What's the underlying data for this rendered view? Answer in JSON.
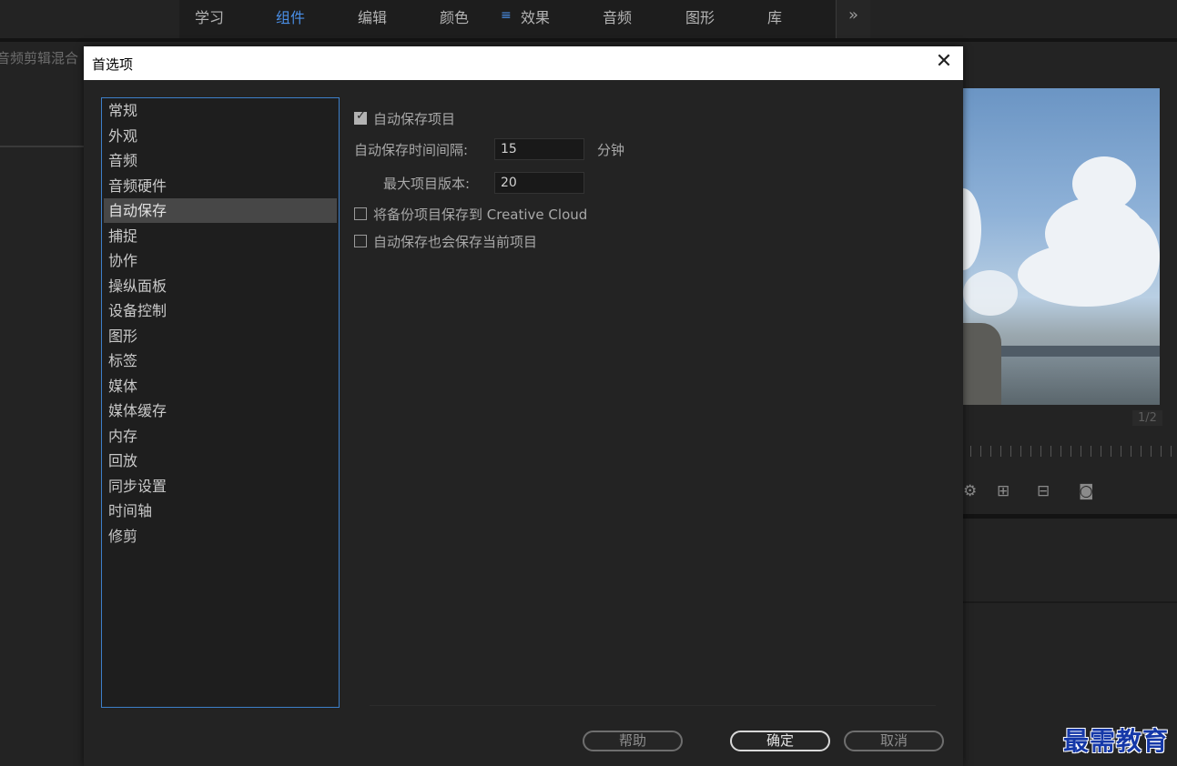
{
  "workspace_tabs": [
    "学习",
    "组件",
    "编辑",
    "颜色",
    "效果",
    "音频",
    "图形",
    "库"
  ],
  "active_tab": "组件",
  "menu_icon": "≡",
  "more_icon": "»",
  "left_panel_title": "音频剪辑混合",
  "program_monitor": {
    "page_indicator": "1/2"
  },
  "dialog": {
    "title": "首选项",
    "close_icon": "close-icon",
    "categories": [
      "常规",
      "外观",
      "音频",
      "音频硬件",
      "自动保存",
      "捕捉",
      "协作",
      "操纵面板",
      "设备控制",
      "图形",
      "标签",
      "媒体",
      "媒体缓存",
      "内存",
      "回放",
      "同步设置",
      "时间轴",
      "修剪"
    ],
    "selected_category": "自动保存",
    "autosave": {
      "enable_label": "自动保存项目",
      "enable_checked": true,
      "interval_label": "自动保存时间间隔:",
      "interval_value": "15",
      "interval_unit": "分钟",
      "max_versions_label": "最大项目版本:",
      "max_versions_value": "20",
      "creative_cloud_label": "将备份项目保存到 Creative Cloud",
      "creative_cloud_checked": false,
      "save_current_label": "自动保存也会保存当前项目",
      "save_current_checked": false
    },
    "buttons": {
      "help": "帮助",
      "ok": "确定",
      "cancel": "取消"
    }
  },
  "watermark": "最需教育",
  "colors": {
    "accent": "#4a8fe7",
    "selection": "#474747",
    "list_border": "#3d7fc9"
  }
}
